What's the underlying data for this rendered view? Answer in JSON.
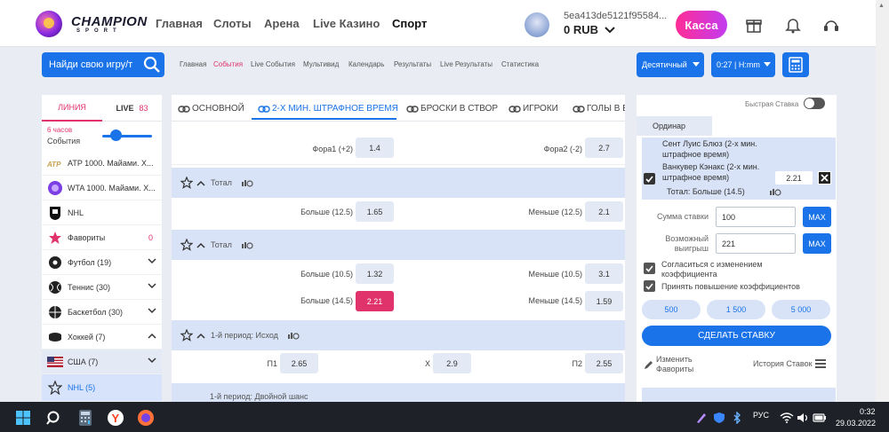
{
  "header": {
    "logo_text": "CHAMPION",
    "logo_sub": "SPORT",
    "nav": [
      "Главная",
      "Слоты",
      "Арена",
      "Live Казино",
      "Спорт"
    ],
    "account_id": "5ea413de5121f95584...",
    "balance": "0 RUB",
    "kassa_label": "Касса"
  },
  "subbar": {
    "search_placeholder": "Найди свою игру/т",
    "crumbs": [
      "Главная",
      "События",
      "Live События",
      "Мультивид",
      "Календарь",
      "Результаты",
      "Live Результаты",
      "Статистика"
    ],
    "odds_format": "Десятичный",
    "time_format": "0:27 | H:mm"
  },
  "sidebar": {
    "tab_line": "ЛИНИЯ",
    "tab_live": "LIVE",
    "live_count": "83",
    "hours": "6 часов",
    "events_label": "События",
    "items": [
      {
        "label": "ATP 1000. Майами. Х...",
        "count": "",
        "icon": "atp-logo-icon"
      },
      {
        "label": "WTA 1000. Майами. Х...",
        "count": "",
        "icon": "wta-logo-icon"
      },
      {
        "label": "NHL",
        "count": "",
        "icon": "nhl-logo-icon"
      },
      {
        "label": "Фавориты",
        "count": "0",
        "icon": "star-icon"
      },
      {
        "label": "Футбол (19)",
        "count": "",
        "icon": "football-icon"
      },
      {
        "label": "Теннис (30)",
        "count": "",
        "icon": "tennis-icon"
      },
      {
        "label": "Баскетбол (30)",
        "count": "",
        "icon": "basketball-icon"
      },
      {
        "label": "Хоккей (7)",
        "count": "",
        "icon": "hockey-puck-icon"
      },
      {
        "label": "США (7)",
        "count": "",
        "icon": "usa-flag-icon"
      },
      {
        "label": "NHL (5)",
        "count": "",
        "icon": "star-outline-icon"
      }
    ]
  },
  "main": {
    "tabs": [
      "ОСНОВНОЙ",
      "2-Х МИН. ШТРАФНОЕ ВРЕМЯ",
      "БРОСКИ В СТВОР",
      "ИГРОКИ",
      "ГОЛЫ В Е"
    ],
    "row_fora": {
      "l1": "Фора1 (+2)",
      "o1": "1.4",
      "l2": "Фора2 (-2)",
      "o2": "2.7"
    },
    "groups": [
      {
        "title": "Тотал",
        "rows": [
          {
            "l1": "Больше (12.5)",
            "o1": "1.65",
            "l2": "Меньше (12.5)",
            "o2": "2.1"
          }
        ]
      },
      {
        "title": "Тотал",
        "rows": [
          {
            "l1": "Больше (10.5)",
            "o1": "1.32",
            "l2": "Меньше (10.5)",
            "o2": "3.1"
          },
          {
            "l1": "Больше (14.5)",
            "o1": "2.21",
            "l2": "Меньше (14.5)",
            "o2": "1.59"
          }
        ]
      },
      {
        "title": "1-й период: Исход",
        "rows": [
          {
            "l1": "П1",
            "o1": "2.65",
            "lx": "Х",
            "ox": "2.9",
            "l2": "П2",
            "o2": "2.55"
          }
        ]
      },
      {
        "title": "1-й период: Двойной шанс"
      }
    ]
  },
  "betslip": {
    "fast_bet": "Быстрая Ставка",
    "ordinar": "Ординар",
    "line1": "Сент Луис Блюз (2-х мин. штрафное время)",
    "line2": "Ванкувер Кэнакс (2-х мин. штрафное время)",
    "line3": "Тотал: Больше (14.5)",
    "odd": "2.21",
    "stake_label": "Сумма ставки",
    "stake_value": "100",
    "win_label": "Возможный выигрыш",
    "win_value": "221",
    "max_label": "MAX",
    "agree_change": "Согласиться с изменением коэффициента",
    "accept_raise": "Принять повышение коэффициентов",
    "quick_amounts": [
      "500",
      "1 500",
      "5 000"
    ],
    "place_bet": "СДЕЛАТЬ СТАВКУ",
    "edit_favorites": "Изменить Фавориты",
    "history": "История Ставок"
  },
  "taskbar": {
    "lang": "РУС",
    "time": "0:32",
    "date": "29.03.2022"
  },
  "colors": {
    "accent": "#1a73e8",
    "pink": "#e0336b",
    "highlight": "#d8e3f7"
  }
}
